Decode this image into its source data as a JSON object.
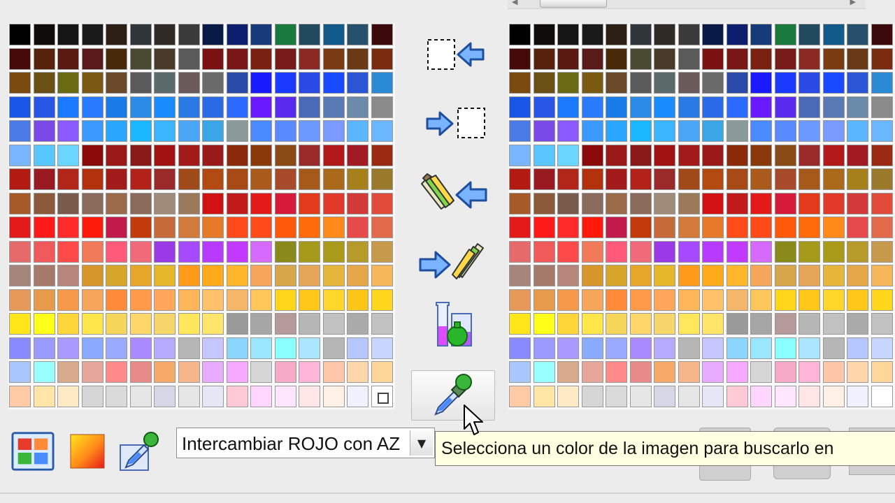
{
  "palette_left": {
    "rows": [
      [
        "#000000",
        "#0f0c0c",
        "#151515",
        "#1a1a1a",
        "#2a1f12",
        "#2f3538",
        "#2f2a26",
        "#3a3a3a",
        "#0a1a46",
        "#0d1e6e",
        "#163a7a",
        "#1a7a3e",
        "#224a5e",
        "#125a8a",
        "#27506c",
        "#3c0a0a"
      ],
      [
        "#460a0a",
        "#56220c",
        "#5a1a12",
        "#5a1a1a",
        "#48290a",
        "#4a4a32",
        "#4a3a2a",
        "#5a5a5a",
        "#7a1212",
        "#7a1616",
        "#7a2212",
        "#761a1a",
        "#8a2a22",
        "#7a3a12",
        "#6a3a16",
        "#7a2a0e"
      ],
      [
        "#7a4a0e",
        "#6a5012",
        "#6a6a12",
        "#7a5a12",
        "#6a4a2a",
        "#5a5a5a",
        "#5a6a6a",
        "#6a5a5a",
        "#6a6a6a",
        "#2a4aaa",
        "#1a1aff",
        "#1a3aff",
        "#2a4ae6",
        "#1a4aff",
        "#2a56d6",
        "#2a8ad6"
      ],
      [
        "#1a56e6",
        "#2a56e6",
        "#1a7aff",
        "#2a7aff",
        "#1a7ae6",
        "#2a8ae6",
        "#1a8aff",
        "#2a7ae6",
        "#2a6ae6",
        "#2a6aff",
        "#6a1aff",
        "#5a2aef",
        "#4a6ab6",
        "#5a7ab6",
        "#6a8aaa",
        "#8a8a8a"
      ],
      [
        "#4a7ae6",
        "#7a4ae6",
        "#8a5aff",
        "#3a9aff",
        "#2aa6ff",
        "#1ab6ff",
        "#3ab6ff",
        "#4aa6f6",
        "#3aa6e6",
        "#8a9a9a",
        "#4a8aff",
        "#5a8aff",
        "#6a9aff",
        "#7a9aff",
        "#5ab6ff",
        "#6ab6ff"
      ],
      [
        "#7ab6ff",
        "#5ac6ff",
        "#6ad6ff",
        "#8a0a0a",
        "#9a1a1a",
        "#8a1a1a",
        "#a21212",
        "#a21a1a",
        "#9a1a1a",
        "#8a2a0a",
        "#8a3a0a",
        "#8a4a16",
        "#9a2a2a",
        "#b21a1a",
        "#a21a22",
        "#9a2a12"
      ],
      [
        "#b21a12",
        "#9a1a22",
        "#b2261a",
        "#b2320e",
        "#a21a1a",
        "#b2221a",
        "#9a2a2a",
        "#a04a1a",
        "#b24a12",
        "#a84a16",
        "#aa5a1a",
        "#a64a2a",
        "#a65a1a",
        "#aa6a1a",
        "#a6801a",
        "#9a7a2a"
      ],
      [
        "#a65a2a",
        "#8a5a3a",
        "#7a5a4a",
        "#8a6a5a",
        "#9a6a4a",
        "#8a6a5a",
        "#a08a7a",
        "#9a7a5a",
        "#d21212",
        "#c21a1a",
        "#e21a1a",
        "#d61a3a",
        "#e23a1a",
        "#e23a2a",
        "#d23a3a",
        "#e24a3a"
      ],
      [
        "#e21a1a",
        "#ff1a1a",
        "#ff2a2a",
        "#ff1a0a",
        "#c21a4a",
        "#c23a0a",
        "#c66a3a",
        "#d27a3a",
        "#e67a2a",
        "#ff4a1a",
        "#ff4a1a",
        "#ff5a0a",
        "#ff6a0a",
        "#ff8a1a",
        "#e64a4a",
        "#e26a4a"
      ],
      [
        "#e66a6a",
        "#f05a5a",
        "#ff4a4a",
        "#f07a5a",
        "#ff5a7a",
        "#f06a7a",
        "#9a3ae6",
        "#a64aff",
        "#b63aff",
        "#c23aff",
        "#d66aff",
        "#8a8a1a",
        "#a69a1a",
        "#aa9a1a",
        "#b69a2a",
        "#c69a4a"
      ],
      [
        "#a6867a",
        "#a67a6a",
        "#b6867a",
        "#d6962a",
        "#d6a62a",
        "#e6a62a",
        "#e6b62a",
        "#ff9a1a",
        "#ffaa1a",
        "#ffb62a",
        "#f6a65a",
        "#d6a64a",
        "#e6a65a",
        "#e6b63a",
        "#e6a64a",
        "#f6b65a"
      ],
      [
        "#e69a5a",
        "#e69a4a",
        "#f69a4a",
        "#f6a65a",
        "#ff8a3a",
        "#ff9a4a",
        "#ffa65a",
        "#ffb65a",
        "#ffc26a",
        "#f6b66a",
        "#ffc65a",
        "#ffd61a",
        "#ffc61a",
        "#ffd62a",
        "#ffc61a",
        "#ffd61a"
      ],
      [
        "#ffe61a",
        "#ffff1a",
        "#ffd63a",
        "#ffe64a",
        "#f6d65a",
        "#ffd66a",
        "#f6d66a",
        "#ffe65a",
        "#ffe66a",
        "#9a9a9a",
        "#a6a6a6",
        "#b69a9a",
        "#b6b6b6",
        "#c2c2c2",
        "#aaaaaa",
        "#c2c2c2"
      ],
      [
        "#8a8aff",
        "#9a9aff",
        "#aa9aff",
        "#8aaaff",
        "#9aaaff",
        "#aa8aff",
        "#b6aaff",
        "#b6b6b6",
        "#c6c6ff",
        "#8ad6ff",
        "#9ae6ff",
        "#8affff",
        "#aae6ff",
        "#b6b6b6",
        "#b6c6ff",
        "#c6d6ff"
      ],
      [
        "#aac6ff",
        "#9affff",
        "#d6aa8a",
        "#e6a69a",
        "#ff8a8a",
        "#e68a8a",
        "#f6aa6a",
        "#f6b68a",
        "#e6aaff",
        "#f6aaff",
        "#d6d6d6",
        "#f6aac6",
        "#ffb6d6",
        "#ffc6aa",
        "#ffd6aa",
        "#ffd69a"
      ],
      [
        "#ffcaa6",
        "#ffe6a6",
        "#ffeac6",
        "#d6d6d6",
        "#dadada",
        "#e6e6e6",
        "#d6d6e6",
        "#e6e6e6",
        "#e6e6f6",
        "#ffcad6",
        "#ffd6ff",
        "#ffe6ff",
        "#ffe6e6",
        "#fff0e6",
        "#f0f0ff",
        "#ffffff"
      ]
    ]
  },
  "palette_right": {
    "rows": [
      [
        "#000000",
        "#0f0c0c",
        "#151515",
        "#1a1a1a",
        "#2a1f12",
        "#2f3538",
        "#2f2a26",
        "#3a3a3a",
        "#0a1a46",
        "#0d1e6e",
        "#163a7a",
        "#1a7a3e",
        "#224a5e",
        "#125a8a",
        "#27506c",
        "#3c0a0a"
      ],
      [
        "#460a0a",
        "#56220c",
        "#5a1a12",
        "#5a1a1a",
        "#48290a",
        "#4a4a32",
        "#4a3a2a",
        "#5a5a5a",
        "#7a1212",
        "#7a1616",
        "#7a2212",
        "#761a1a",
        "#8a2a22",
        "#7a3a12",
        "#6a3a16",
        "#7a2a0e"
      ],
      [
        "#7a4a0e",
        "#6a5012",
        "#6a6a12",
        "#7a5a12",
        "#6a4a2a",
        "#5a5a5a",
        "#5a6a6a",
        "#6a5a5a",
        "#6a6a6a",
        "#2a4aaa",
        "#1a1aff",
        "#1a3aff",
        "#2a4ae6",
        "#1a4aff",
        "#2a56d6",
        "#2a8ad6"
      ],
      [
        "#1a56e6",
        "#2a56e6",
        "#1a7aff",
        "#2a7aff",
        "#1a7ae6",
        "#2a8ae6",
        "#1a8aff",
        "#2a7ae6",
        "#2a6ae6",
        "#2a6aff",
        "#6a1aff",
        "#5a2aef",
        "#4a6ab6",
        "#5a7ab6",
        "#6a8aaa",
        "#8a8a8a"
      ],
      [
        "#4a7ae6",
        "#7a4ae6",
        "#8a5aff",
        "#3a9aff",
        "#2aa6ff",
        "#1ab6ff",
        "#3ab6ff",
        "#4aa6f6",
        "#3aa6e6",
        "#8a9a9a",
        "#4a8aff",
        "#5a8aff",
        "#6a9aff",
        "#7a9aff",
        "#5ab6ff",
        "#6ab6ff"
      ],
      [
        "#7ab6ff",
        "#5ac6ff",
        "#6ad6ff",
        "#8a0a0a",
        "#9a1a1a",
        "#8a1a1a",
        "#a21212",
        "#a21a1a",
        "#9a1a1a",
        "#8a2a0a",
        "#8a3a0a",
        "#8a4a16",
        "#9a2a2a",
        "#b21a1a",
        "#a21a22",
        "#9a2a12"
      ],
      [
        "#b21a12",
        "#9a1a22",
        "#b2261a",
        "#b2320e",
        "#a21a1a",
        "#b2221a",
        "#9a2a2a",
        "#a04a1a",
        "#b24a12",
        "#a84a16",
        "#aa5a1a",
        "#a64a2a",
        "#a65a1a",
        "#aa6a1a",
        "#a6801a",
        "#9a7a2a"
      ],
      [
        "#a65a2a",
        "#8a5a3a",
        "#7a5a4a",
        "#8a6a5a",
        "#9a6a4a",
        "#8a6a5a",
        "#a08a7a",
        "#9a7a5a",
        "#d21212",
        "#c21a1a",
        "#e21a1a",
        "#d61a3a",
        "#e23a1a",
        "#e23a2a",
        "#d23a3a",
        "#e24a3a"
      ],
      [
        "#e21a1a",
        "#ff1a1a",
        "#ff2a2a",
        "#ff1a0a",
        "#c21a4a",
        "#c23a0a",
        "#c66a3a",
        "#d27a3a",
        "#e67a2a",
        "#ff4a1a",
        "#ff4a1a",
        "#ff5a0a",
        "#ff6a0a",
        "#ff8a1a",
        "#e64a4a",
        "#e26a4a"
      ],
      [
        "#e66a6a",
        "#f05a5a",
        "#ff4a4a",
        "#f07a5a",
        "#ff5a7a",
        "#f06a7a",
        "#9a3ae6",
        "#a64aff",
        "#b63aff",
        "#c23aff",
        "#d66aff",
        "#8a8a1a",
        "#a69a1a",
        "#aa9a1a",
        "#b69a2a",
        "#c69a4a"
      ],
      [
        "#a6867a",
        "#a67a6a",
        "#b6867a",
        "#d6962a",
        "#d6a62a",
        "#e6a62a",
        "#e6b62a",
        "#ff9a1a",
        "#ffaa1a",
        "#ffb62a",
        "#f6a65a",
        "#d6a64a",
        "#e6a65a",
        "#e6b63a",
        "#e6a64a",
        "#f6b65a"
      ],
      [
        "#e69a5a",
        "#e69a4a",
        "#f69a4a",
        "#f6a65a",
        "#ff8a3a",
        "#ff9a4a",
        "#ffa65a",
        "#ffb65a",
        "#ffc26a",
        "#f6b66a",
        "#ffc65a",
        "#ffd61a",
        "#ffc61a",
        "#ffd62a",
        "#ffc61a",
        "#ffd61a"
      ],
      [
        "#ffe61a",
        "#ffff1a",
        "#ffd63a",
        "#ffe64a",
        "#f6d65a",
        "#ffd66a",
        "#f6d66a",
        "#ffe65a",
        "#ffe66a",
        "#9a9a9a",
        "#a6a6a6",
        "#b69a9a",
        "#b6b6b6",
        "#c2c2c2",
        "#aaaaaa",
        "#c2c2c2"
      ],
      [
        "#8a8aff",
        "#9a9aff",
        "#aa9aff",
        "#8aaaff",
        "#9aaaff",
        "#aa8aff",
        "#b6aaff",
        "#b6b6b6",
        "#c6c6ff",
        "#8ad6ff",
        "#9ae6ff",
        "#8affff",
        "#aae6ff",
        "#b6b6b6",
        "#b6c6ff",
        "#c6d6ff"
      ],
      [
        "#aac6ff",
        "#9affff",
        "#d6aa8a",
        "#e6a69a",
        "#ff8a8a",
        "#e68a8a",
        "#f6aa6a",
        "#f6b68a",
        "#e6aaff",
        "#f6aaff",
        "#d6d6d6",
        "#f6aac6",
        "#ffb6d6",
        "#ffc6aa",
        "#ffd6aa",
        "#ffd69a"
      ],
      [
        "#ffcaa6",
        "#ffe6a6",
        "#ffeac6",
        "#d6d6d6",
        "#dadada",
        "#e6e6e6",
        "#d6d6e6",
        "#e6e6e6",
        "#e6e6f6",
        "#ffcad6",
        "#ffd6ff",
        "#ffe6ff",
        "#ffe6e6",
        "#fff0e6",
        "#f0f0ff",
        "#ffffff"
      ]
    ]
  },
  "side_buttons": [
    {
      "name": "copy-to-selection-button",
      "icon": "dashed-square-arrow-left-icon"
    },
    {
      "name": "copy-from-selection-button",
      "icon": "arrow-right-dashed-square-icon"
    },
    {
      "name": "apply-pencils-left-button",
      "icon": "pencils-arrow-left-icon"
    },
    {
      "name": "apply-pencils-right-button",
      "icon": "arrow-right-pencils-icon"
    },
    {
      "name": "mix-colors-button",
      "icon": "beakers-icon"
    },
    {
      "name": "pick-color-button",
      "icon": "eyedropper-icon",
      "active": true
    }
  ],
  "bottom_tools": [
    {
      "name": "palette-view-button",
      "icon": "palette-grid-icon"
    },
    {
      "name": "gradient-button",
      "icon": "gradient-square-icon"
    },
    {
      "name": "eyedropper-tool-button",
      "icon": "eyedropper-icon"
    }
  ],
  "operation_select": {
    "value": "Intercambiar ROJO con AZ"
  },
  "tooltip": {
    "text": "Selecciona un color de la imagen para buscarlo en"
  }
}
